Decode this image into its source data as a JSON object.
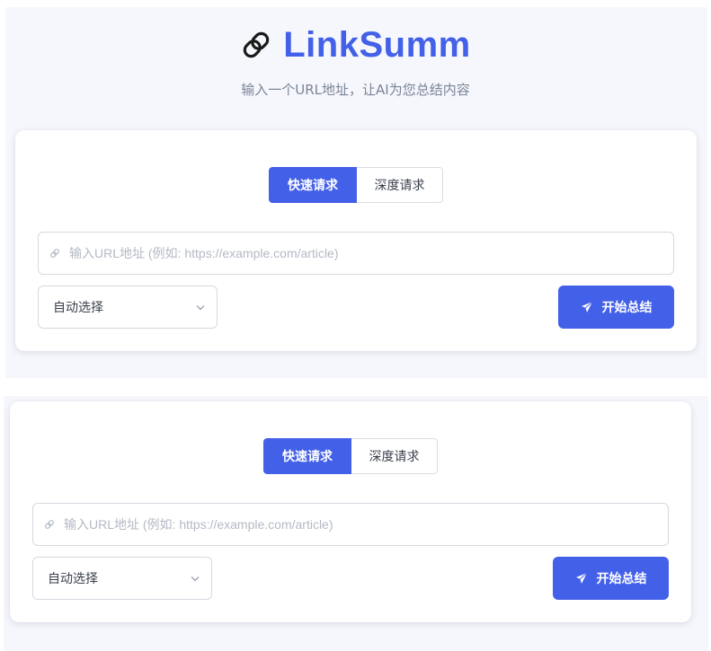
{
  "header": {
    "icon": "link-icon",
    "title": "LinkSumm",
    "subtitle": "输入一个URL地址，让AI为您总结内容"
  },
  "forms": [
    {
      "tabs": [
        {
          "label": "快速请求",
          "active": true
        },
        {
          "label": "深度请求",
          "active": false
        }
      ],
      "url_input": {
        "value": "",
        "placeholder": "输入URL地址 (例如: https://example.com/article)",
        "icon": "link-icon"
      },
      "model_select": {
        "selected": "自动选择",
        "icon": "chevron-down-icon"
      },
      "submit": {
        "label": "开始总结",
        "icon": "send-icon"
      }
    },
    {
      "tabs": [
        {
          "label": "快速请求",
          "active": true
        },
        {
          "label": "深度请求",
          "active": false
        }
      ],
      "url_input": {
        "value": "",
        "placeholder": "输入URL地址 (例如: https://example.com/article)",
        "icon": "link-icon"
      },
      "model_select": {
        "selected": "自动选择",
        "icon": "chevron-down-icon"
      },
      "submit": {
        "label": "开始总结",
        "icon": "send-icon"
      }
    }
  ],
  "colors": {
    "accent": "#4360e8",
    "background": "#f6f7fc",
    "card": "#ffffff",
    "border": "#d6d9e0",
    "muted_text": "#7b8496",
    "placeholder": "#b4b9c4"
  }
}
